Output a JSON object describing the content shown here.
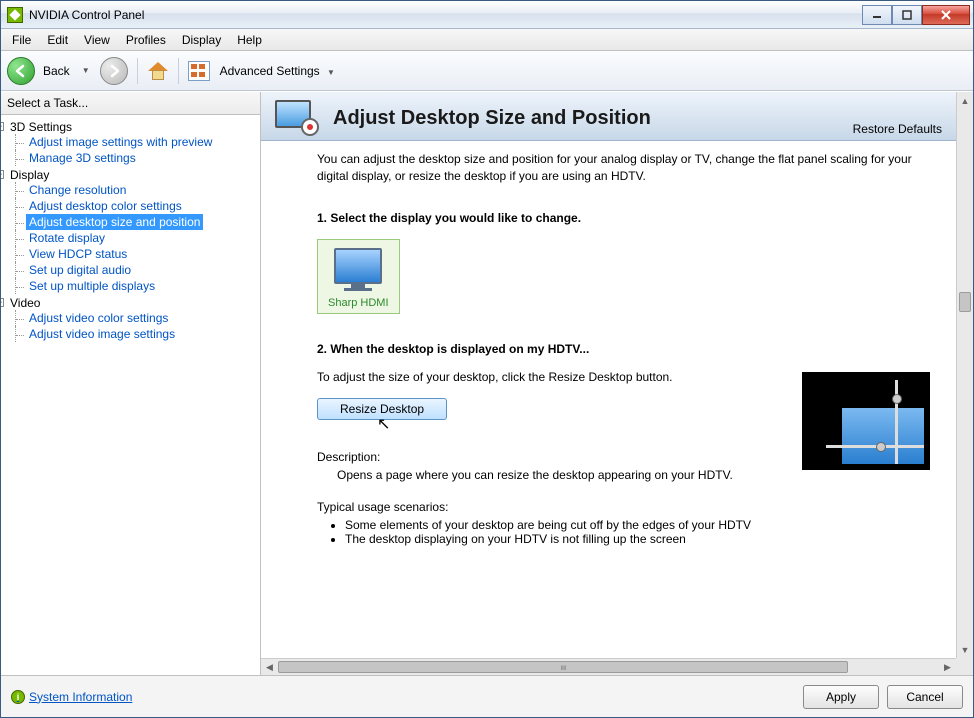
{
  "window": {
    "title": "NVIDIA Control Panel"
  },
  "menubar": [
    "File",
    "Edit",
    "View",
    "Profiles",
    "Display",
    "Help"
  ],
  "toolbar": {
    "back": "Back",
    "advanced": "Advanced Settings"
  },
  "sidebar": {
    "header": "Select a Task...",
    "groups": [
      {
        "label": "3D Settings",
        "items": [
          "Adjust image settings with preview",
          "Manage 3D settings"
        ]
      },
      {
        "label": "Display",
        "items": [
          "Change resolution",
          "Adjust desktop color settings",
          "Adjust desktop size and position",
          "Rotate display",
          "View HDCP status",
          "Set up digital audio",
          "Set up multiple displays"
        ]
      },
      {
        "label": "Video",
        "items": [
          "Adjust video color settings",
          "Adjust video image settings"
        ]
      }
    ],
    "selected": "Adjust desktop size and position"
  },
  "page": {
    "title": "Adjust Desktop Size and Position",
    "restore": "Restore Defaults",
    "intro": "You can adjust the desktop size and position for your analog display or TV, change the flat panel scaling for your digital display, or resize the desktop if you are using an HDTV.",
    "step1": {
      "title": "1. Select the display you would like to change.",
      "display_label": "Sharp HDMI"
    },
    "step2": {
      "title": "2. When the desktop is displayed on my HDTV...",
      "text": "To adjust the size of your desktop, click the Resize Desktop button.",
      "button": "Resize Desktop"
    },
    "description": {
      "head": "Description:",
      "body": "Opens a page where you can resize the desktop appearing on your HDTV."
    },
    "usage": {
      "head": "Typical usage scenarios:",
      "items": [
        "Some elements of your desktop are being cut off by the edges of your HDTV",
        "The desktop displaying on your HDTV is not filling up the screen"
      ]
    }
  },
  "footer": {
    "sysinfo": "System Information",
    "apply": "Apply",
    "cancel": "Cancel"
  }
}
